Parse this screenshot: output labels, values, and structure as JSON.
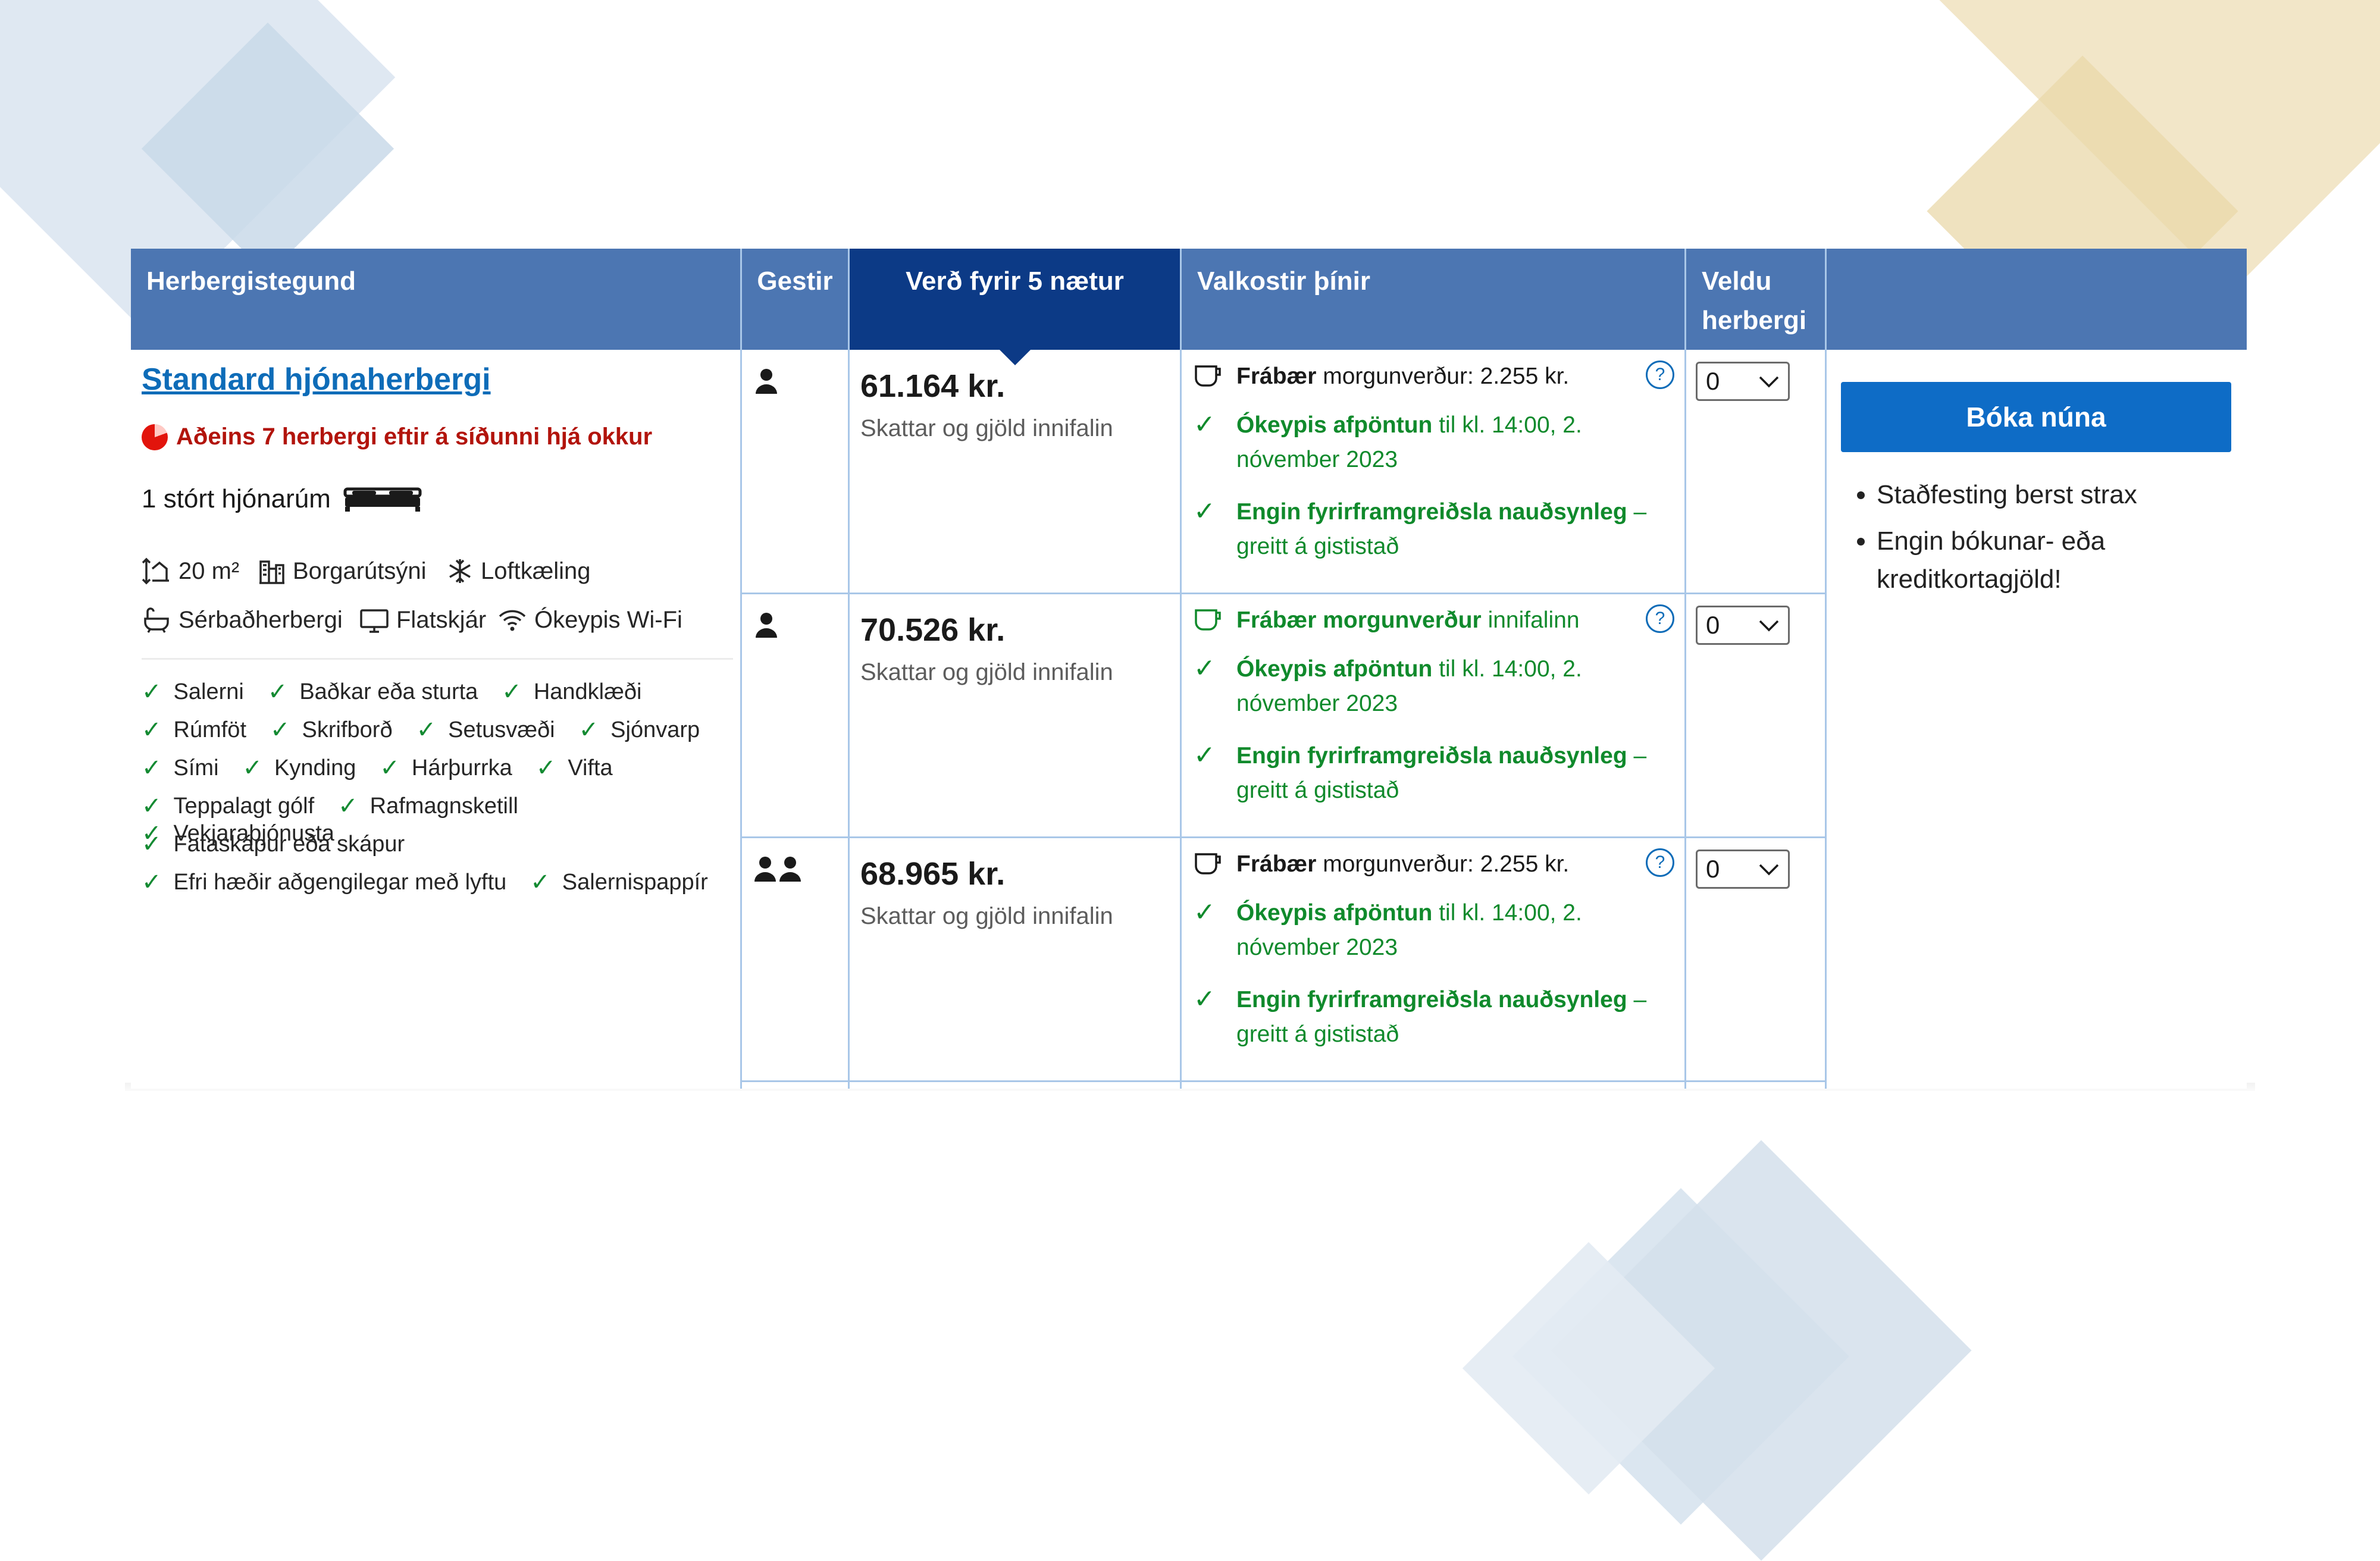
{
  "table": {
    "headers": {
      "room_type": "Herbergistegund",
      "guests": "Gestir",
      "price": "Verð fyrir 5 nætur",
      "options": "Valkostir þínir",
      "select": "Veldu herbergi"
    }
  },
  "room": {
    "name": "Standard hjónaherbergi",
    "availability": "Aðeins 7 herbergi eftir á síðunni hjá okkur",
    "bed": "1 stórt hjónarúm",
    "features": [
      {
        "icon": "room-size-icon",
        "label": "20 m²"
      },
      {
        "icon": "city-view-icon",
        "label": "Borgarútsýni"
      },
      {
        "icon": "snowflake-icon",
        "label": "Loftkæling"
      },
      {
        "icon": "bath-icon",
        "label": "Sérbaðherbergi"
      },
      {
        "icon": "tv-icon",
        "label": "Flatskjár"
      },
      {
        "icon": "wifi-icon",
        "label": "Ókeypis Wi-Fi"
      }
    ],
    "amenities": [
      "Salerni",
      "Baðkar eða sturta",
      "Handklæði",
      "Rúmföt",
      "Skrifborð",
      "Setusvæði",
      "Sjónvarp",
      "Sími",
      "Kynding",
      "Hárþurrka",
      "Vifta",
      "Teppalagt gólf",
      "Rafmagnsketill",
      "Vekjaraþjónusta",
      "Fataskápur eða skápur",
      "Efri hæðir aðgengilegar með lyftu",
      "Salernispappír"
    ]
  },
  "rows": [
    {
      "guests": 1,
      "price": "61.164 kr.",
      "tax_note": "Skattar og gjöld innifalin",
      "breakfast_bold": "Frábær",
      "breakfast_rest": " morgunverður: 2.255 kr.",
      "cancel_bold": "Ókeypis afpöntun",
      "cancel_rest": " til kl. 14:00, 2. nóvember 2023",
      "prepay_bold": "Engin fyrirframgreiðsla nauðsynleg",
      "prepay_rest": " – greitt á gististað",
      "help": "?",
      "selected": "0"
    },
    {
      "guests": 1,
      "price": "70.526 kr.",
      "tax_note": "Skattar og gjöld innifalin",
      "breakfast_bold": "Frábær morgunverður",
      "breakfast_rest": " innifalinn",
      "cancel_bold": "Ókeypis afpöntun",
      "cancel_rest": " til kl. 14:00, 2. nóvember 2023",
      "prepay_bold": "Engin fyrirframgreiðsla nauðsynleg",
      "prepay_rest": " – greitt á gististað",
      "help": "?",
      "selected": "0"
    },
    {
      "guests": 2,
      "price": "68.965 kr.",
      "tax_note": "Skattar og gjöld innifalin",
      "breakfast_bold": "Frábær",
      "breakfast_rest": " morgunverður: 2.255 kr.",
      "cancel_bold": "Ókeypis afpöntun",
      "cancel_rest": " til kl. 14:00, 2. nóvember 2023",
      "prepay_bold": "Engin fyrirframgreiðsla nauðsynleg",
      "prepay_rest": " – greitt á gististað",
      "help": "?",
      "selected": "0"
    }
  ],
  "booking": {
    "button": "Bóka núna",
    "bullets": [
      "Staðfesting berst strax",
      "Engin bókunar- eða kreditkortagjöld!"
    ]
  },
  "colors": {
    "header": "#4c76b2",
    "header_selected": "#0c3a86",
    "link": "#0e6cb8",
    "green": "#108a2c",
    "red": "#b2140c",
    "button": "#0e6cc6"
  }
}
